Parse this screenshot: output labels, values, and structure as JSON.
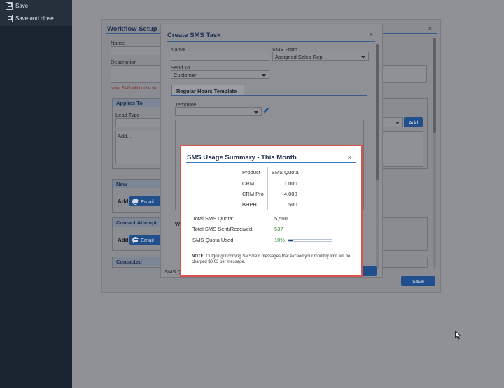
{
  "sidebar": {
    "items": [
      {
        "label": "Save",
        "icon": "save-icon"
      },
      {
        "label": "Save and close",
        "icon": "save-close-icon"
      }
    ]
  },
  "workflow": {
    "title": "Workflow Setup",
    "close_icon": "close-icon",
    "name_label": "Name",
    "description_label": "Description",
    "note": "Note: SMS will not be se",
    "applies_to": {
      "header": "Applies To",
      "lead_type_label": "Lead Type",
      "add_placeholder": "Add..."
    },
    "add_button": "Add",
    "sections": [
      {
        "header": "New",
        "add_label": "Add",
        "button": "Email"
      },
      {
        "header": "Contact Attempt",
        "add_label": "Add",
        "button": "Email"
      },
      {
        "header": "Contacted"
      }
    ],
    "save_button": "Save"
  },
  "sms_task": {
    "title": "Create SMS Task",
    "close_icon": "close-icon",
    "name_label": "Name",
    "sms_from_label": "SMS From",
    "sms_from_value": "Assigned Sales Rep",
    "send_to_label": "Send To",
    "send_to_value": "Customer",
    "tab": "Regular Hours Template",
    "template_label": "Template",
    "footer_label": "SMS Q",
    "w_label": "W"
  },
  "usage_dialog": {
    "title": "SMS Usage Summary - This Month",
    "close_icon": "close-icon",
    "columns": [
      "Product",
      "SMS Quota"
    ],
    "rows": [
      {
        "product": "CRM",
        "quota": "1,000"
      },
      {
        "product": "CRM Pro",
        "quota": "4,000"
      },
      {
        "product": "BHPH",
        "quota": "500"
      }
    ],
    "total_quota_label": "Total SMS Quota:",
    "total_quota_value": "5,500",
    "total_sent_label": "Total SMS Sent/Received:",
    "total_sent_value": "537",
    "used_label": "SMS Quota Used:",
    "used_value": "10%",
    "used_fraction": 0.1,
    "note_bold": "NOTE:",
    "note_text": " Outgoing/Incoming SMS/Text messages that exceed your monthly limit will be charged $0.03 per message."
  },
  "colors": {
    "sidebar": "#1b2431",
    "accent": "#1f4f8f",
    "dialog_border": "#d9534f",
    "success": "#2d8a2d"
  }
}
